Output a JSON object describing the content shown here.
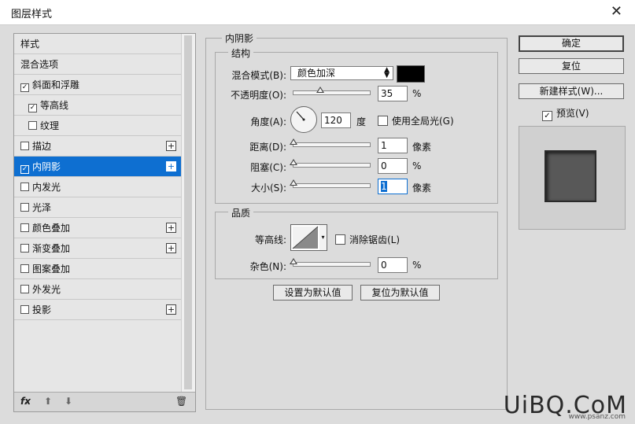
{
  "window": {
    "title": "图层样式"
  },
  "style_list": {
    "items": [
      {
        "label": "样式",
        "checkbox": false,
        "checked": false,
        "plus": false
      },
      {
        "label": "混合选项",
        "checkbox": false,
        "checked": false,
        "plus": false
      },
      {
        "label": "斜面和浮雕",
        "checkbox": true,
        "checked": true,
        "plus": false
      },
      {
        "label": "等高线",
        "checkbox": true,
        "checked": true,
        "plus": false
      },
      {
        "label": "纹理",
        "checkbox": true,
        "checked": false,
        "plus": false
      },
      {
        "label": "描边",
        "checkbox": true,
        "checked": false,
        "plus": true
      },
      {
        "label": "内阴影",
        "checkbox": true,
        "checked": true,
        "plus": true
      },
      {
        "label": "内发光",
        "checkbox": true,
        "checked": false,
        "plus": false
      },
      {
        "label": "光泽",
        "checkbox": true,
        "checked": false,
        "plus": false
      },
      {
        "label": "颜色叠加",
        "checkbox": true,
        "checked": false,
        "plus": true
      },
      {
        "label": "渐变叠加",
        "checkbox": true,
        "checked": false,
        "plus": true
      },
      {
        "label": "图案叠加",
        "checkbox": true,
        "checked": false,
        "plus": false
      },
      {
        "label": "外发光",
        "checkbox": true,
        "checked": false,
        "plus": false
      },
      {
        "label": "投影",
        "checkbox": true,
        "checked": false,
        "plus": true
      }
    ],
    "selected": "内阴影",
    "toolbar": {
      "fx": "fx",
      "up_icon": "arrow-up-icon",
      "down_icon": "arrow-down-icon",
      "trash_icon": "trash-icon"
    }
  },
  "panel": {
    "title": "内阴影",
    "structure": {
      "title": "结构",
      "blend_mode_label": "混合模式(B):",
      "blend_mode_value": "颜色加深",
      "shadow_color": "#000000",
      "opacity_label": "不透明度(O):",
      "opacity_value": "35",
      "opacity_unit": "%",
      "opacity_level": 0.35,
      "angle_label": "角度(A):",
      "angle_value": "120",
      "angle_unit": "度",
      "global_light_label": "使用全局光(G)",
      "global_light_checked": false,
      "distance_label": "距离(D):",
      "distance_value": "1",
      "distance_unit": "像素",
      "distance_level": 0.0,
      "choke_label": "阻塞(C):",
      "choke_value": "0",
      "choke_unit": "%",
      "choke_level": 0.0,
      "size_label": "大小(S):",
      "size_value": "1",
      "size_unit": "像素",
      "size_level": 0.0
    },
    "quality": {
      "title": "品质",
      "contour_label": "等高线:",
      "anti_alias_label": "消除锯齿(L)",
      "anti_alias_checked": false,
      "noise_label": "杂色(N):",
      "noise_value": "0",
      "noise_unit": "%",
      "noise_level": 0.0
    },
    "buttons": {
      "make_default": "设置为默认值",
      "reset_default": "复位为默认值"
    }
  },
  "right": {
    "ok": "确定",
    "reset": "复位",
    "new_style": "新建样式(W)...",
    "preview_label": "预览(V)",
    "preview_checked": true
  },
  "watermark": {
    "brand": "UiBQ.CoM",
    "sub": "www.psanz.com"
  }
}
